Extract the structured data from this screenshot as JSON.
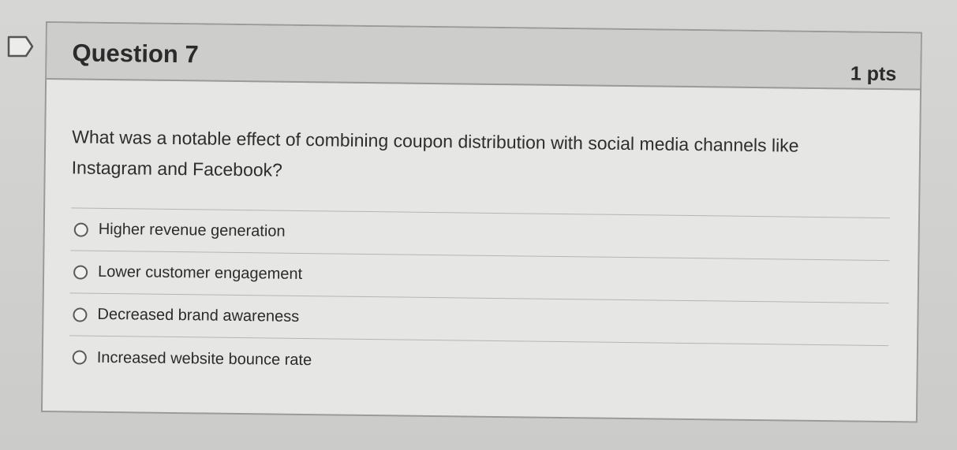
{
  "question": {
    "title": "Question 7",
    "points": "1 pts",
    "prompt": "What was a notable effect of combining coupon distribution with social media channels like Instagram and Facebook?"
  },
  "answers": [
    {
      "label": "Higher revenue generation",
      "selected": false
    },
    {
      "label": "Lower customer engagement",
      "selected": false
    },
    {
      "label": "Decreased brand awareness",
      "selected": false
    },
    {
      "label": "Increased website bounce rate",
      "selected": false
    }
  ],
  "colors": {
    "background": "#cfcfcd",
    "card": "#e6e6e4",
    "header": "#cdcdcb",
    "border": "#9a9a98",
    "text": "#2b2b2b"
  },
  "icons": {
    "flag": "flag-outline-icon",
    "radio": "radio-unselected-icon"
  }
}
